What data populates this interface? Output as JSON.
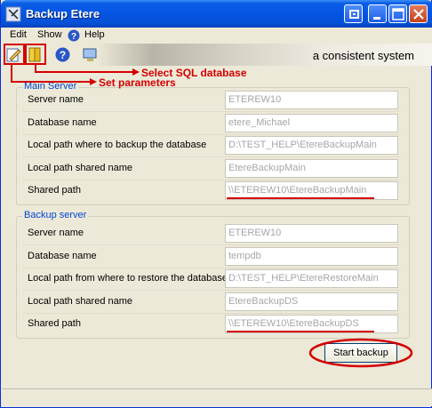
{
  "window": {
    "title": "Backup Etere"
  },
  "menu": [
    "Edit",
    "Show",
    "Help"
  ],
  "toolbar": {
    "tagline": "a consistent system"
  },
  "annotations": {
    "select_sql": "Select SQL database",
    "set_params": "Set parameters"
  },
  "main_server": {
    "title": "Main Server",
    "rows": [
      {
        "label": "Server name",
        "value": "ETEREW10"
      },
      {
        "label": "Database name",
        "value": "etere_Michael"
      },
      {
        "label": "Local path where to backup the database",
        "value": "D:\\TEST_HELP\\EtereBackupMain"
      },
      {
        "label": "Local path shared name",
        "value": "EtereBackupMain"
      },
      {
        "label": "Shared path",
        "value": "\\\\ETEREW10\\EtereBackupMain"
      }
    ]
  },
  "backup_server": {
    "title": "Backup server",
    "rows": [
      {
        "label": "Server name",
        "value": "ETEREW10"
      },
      {
        "label": "Database name",
        "value": "tempdb"
      },
      {
        "label": "Local path from where to restore the database",
        "value": "D:\\TEST_HELP\\EtereRestoreMain"
      },
      {
        "label": "Local path shared name",
        "value": "EtereBackupDS"
      },
      {
        "label": "Shared path",
        "value": "\\\\ETEREW10\\EtereBackupDS"
      }
    ]
  },
  "buttons": {
    "start_backup": "Start backup"
  },
  "colors": {
    "annotation": "#d40000",
    "group_title": "#0046d5",
    "titlebar": "#0554e3"
  }
}
